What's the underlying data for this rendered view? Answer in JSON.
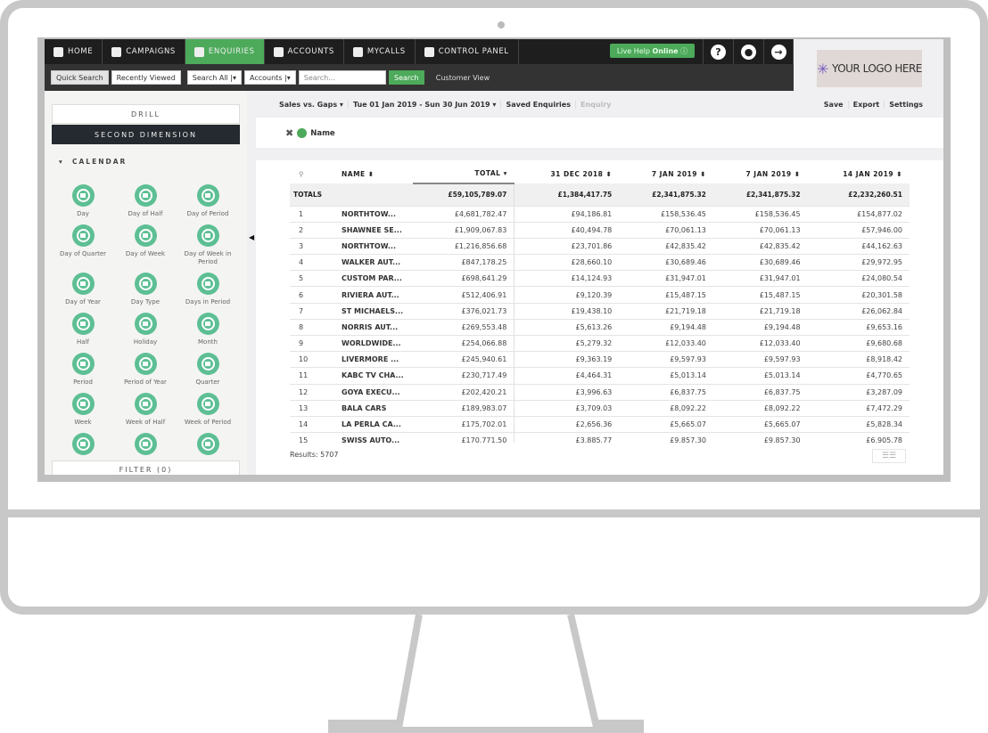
{
  "nav": {
    "items": [
      {
        "label": "HOME",
        "icon": "home-icon"
      },
      {
        "label": "CAMPAIGNS",
        "icon": "campaigns-icon"
      },
      {
        "label": "ENQUIRIES",
        "icon": "enquiries-icon",
        "active": true
      },
      {
        "label": "ACCOUNTS",
        "icon": "bank-icon"
      },
      {
        "label": "MYCALLS",
        "icon": "calls-icon"
      },
      {
        "label": "CONTROL PANEL",
        "icon": "grid-icon"
      }
    ],
    "live_help": "Live Help",
    "live_status": "Online",
    "help": "?"
  },
  "searchbar": {
    "quick_search": "Quick Search",
    "recently_viewed": "Recently Viewed",
    "scope": "Search All",
    "type": "Accounts",
    "placeholder": "Search...",
    "search": "Search",
    "customer_view": "Customer View"
  },
  "logo": "YOUR LOGO HERE",
  "left": {
    "drill": "DRILL",
    "second_dimension": "SECOND DIMENSION",
    "section": "CALENDAR",
    "filter": "FILTER (0)",
    "items": [
      "Day",
      "Day of Half",
      "Day of Period",
      "Day of Quarter",
      "Day of Week",
      "Day of Week in Period",
      "Day of Year",
      "Day Type",
      "Days in Period",
      "Half",
      "Holiday",
      "Month",
      "Period",
      "Period of Year",
      "Quarter",
      "Week",
      "Week of Half",
      "Week of Period",
      "",
      "",
      ""
    ]
  },
  "toolbar": {
    "report": "Sales vs. Gaps ▾",
    "range": "Tue 01 Jan 2019 - Sun 30 Jun 2019 ▾",
    "saved": "Saved Enquiries",
    "enquiry": "Enquiry",
    "save": "Save",
    "export": "Export",
    "settings": "Settings"
  },
  "chip": {
    "label": "Name"
  },
  "table": {
    "headers": [
      "NAME ⬍",
      "TOTAL ▾",
      "31 DEC 2018 ⬍",
      "7 JAN 2019 ⬍",
      "7 JAN 2019 ⬍",
      "14 JAN 2019 ⬍"
    ],
    "totals": [
      "TOTALS",
      "£59,105,789.07",
      "£1,384,417.75",
      "£2,341,875.32",
      "£2,341,875.32",
      "£2,232,260.51"
    ],
    "rows": [
      [
        "1",
        "NORTHTOW...",
        "£4,681,782.47",
        "£94,186.81",
        "£158,536.45",
        "£158,536.45",
        "£154,877.02"
      ],
      [
        "2",
        "SHAWNEE SE...",
        "£1,909,067.83",
        "£40,494.78",
        "£70,061.13",
        "£70,061.13",
        "£57,946.00"
      ],
      [
        "3",
        "NORTHTOW...",
        "£1,216,856.68",
        "£23,701.86",
        "£42,835.42",
        "£42,835.42",
        "£44,162.63"
      ],
      [
        "4",
        "WALKER AUT...",
        "£847,178.25",
        "£28,660.10",
        "£30,689.46",
        "£30,689.46",
        "£29,972.95"
      ],
      [
        "5",
        "CUSTOM PAR...",
        "£698,641.29",
        "£14,124.93",
        "£31,947.01",
        "£31,947.01",
        "£24,080.54"
      ],
      [
        "6",
        "RIVIERA AUT...",
        "£512,406.91",
        "£9,120.39",
        "£15,487.15",
        "£15,487.15",
        "£20,301.58"
      ],
      [
        "7",
        "ST MICHAELS...",
        "£376,021.73",
        "£19,438.10",
        "£21,719.18",
        "£21,719.18",
        "£26,062.84"
      ],
      [
        "8",
        "NORRIS AUT...",
        "£269,553.48",
        "£5,613.26",
        "£9,194.48",
        "£9,194.48",
        "£9,653.16"
      ],
      [
        "9",
        "WORLDWIDE...",
        "£254,066.88",
        "£5,279.32",
        "£12,033.40",
        "£12,033.40",
        "£9,680.68"
      ],
      [
        "10",
        "LIVERMORE ...",
        "£245,940.61",
        "£9,363.19",
        "£9,597.93",
        "£9,597.93",
        "£8,918.42"
      ],
      [
        "11",
        "KABC TV CHA...",
        "£230,717.49",
        "£4,464.31",
        "£5,013.14",
        "£5,013.14",
        "£4,770.65"
      ],
      [
        "12",
        "GOYA EXECU...",
        "£202,420.21",
        "£3,996.63",
        "£6,837.75",
        "£6,837.75",
        "£3,287.09"
      ],
      [
        "13",
        "BALA CARS",
        "£189,983.07",
        "£3,709.03",
        "£8,092.22",
        "£8,092.22",
        "£7,472.29"
      ],
      [
        "14",
        "LA PERLA CA...",
        "£175,702.01",
        "£2,656.36",
        "£5,665.07",
        "£5,665.07",
        "£5,828.34"
      ],
      [
        "15",
        "SWISS AUTO...",
        "£170,771.50",
        "£3,885.77",
        "£9,857.30",
        "£9,857.30",
        "£6,905.78"
      ]
    ]
  },
  "results": "Results: 5707",
  "colors": {
    "accent": "#4caa5a",
    "icon_green": "#5dbf94",
    "nav_bg": "#1e1e1e"
  }
}
